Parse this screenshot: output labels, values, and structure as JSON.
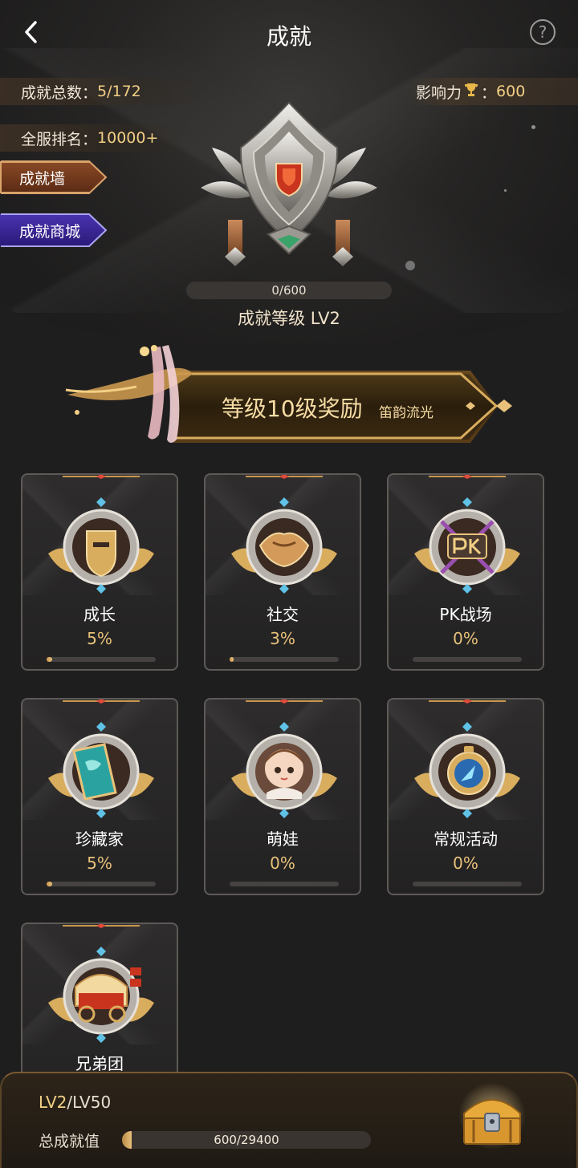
{
  "header": {
    "title": "成就",
    "back_icon": "chevron-left-icon",
    "help_icon": "question-circle-icon",
    "help_glyph": "?"
  },
  "stats": {
    "total_label": "成就总数：",
    "total_value": "5/172",
    "rank_label": "全服排名：",
    "rank_value": "10000+",
    "influence_label": "影响力",
    "influence_sep": "：",
    "influence_value": "600"
  },
  "side_buttons": {
    "wall": "成就墙",
    "shop": "成就商城"
  },
  "level": {
    "progress_text": "0/600",
    "progress_fraction": 0,
    "level_text": "成就等级 LV2"
  },
  "reward": {
    "title": "等级10级奖励",
    "subtitle": "笛韵流光"
  },
  "categories": [
    {
      "label": "成长",
      "percent": "5%",
      "fill": 0.05,
      "icon": "helmet-icon"
    },
    {
      "label": "社交",
      "percent": "3%",
      "fill": 0.03,
      "icon": "handshake-icon"
    },
    {
      "label": "PK战场",
      "percent": "0%",
      "fill": 0,
      "icon": "pk-swords-icon"
    },
    {
      "label": "珍藏家",
      "percent": "5%",
      "fill": 0.05,
      "icon": "treasure-book-icon"
    },
    {
      "label": "萌娃",
      "percent": "0%",
      "fill": 0,
      "icon": "baby-icon"
    },
    {
      "label": "常规活动",
      "percent": "0%",
      "fill": 0,
      "icon": "compass-icon"
    },
    {
      "label": "兄弟团",
      "percent": "",
      "fill": 0,
      "icon": "wagon-icon"
    }
  ],
  "bottom": {
    "level_current": "LV2",
    "level_max": "/LV50",
    "total_label": "总成就值",
    "total_text": "600/29400",
    "total_fraction": 0.0204,
    "chest_icon": "treasure-chest-icon"
  },
  "colors": {
    "gold": "#f2cf84",
    "wall_button": "#7a3c1e",
    "shop_button": "#3a25a0",
    "background": "#1f1e1f"
  }
}
